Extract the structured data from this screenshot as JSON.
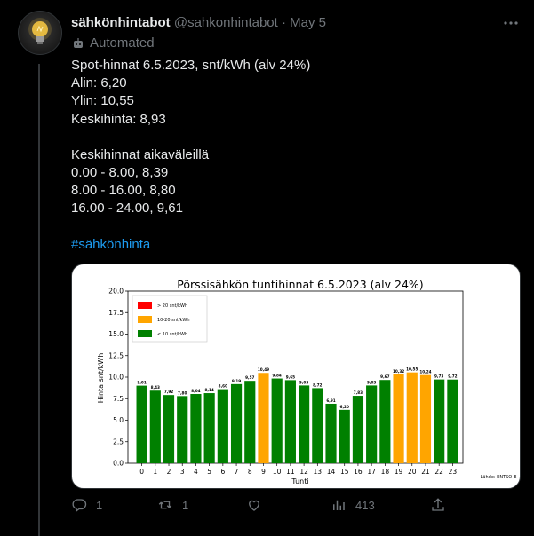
{
  "tweet": {
    "display_name": "sähkönhintabot",
    "handle": "@sahkonhintabot",
    "separator": "·",
    "date": "May 5",
    "automated_label": "Automated",
    "lines": [
      "Spot-hinnat 6.5.2023, snt/kWh (alv 24%)",
      "Alin: 6,20",
      "Ylin: 10,55",
      "Keskihinta: 8,93",
      "",
      "Keskihinnat aikaväleillä",
      "0.00 - 8.00, 8,39",
      "8.00 - 16.00, 8,80",
      "16.00 - 24.00, 9,61",
      ""
    ],
    "hashtag": "#sähkönhinta"
  },
  "actions": {
    "replies": "1",
    "retweets": "1",
    "likes": "",
    "views": "413"
  },
  "icons": {
    "more": "more-icon",
    "automated": "bot-icon",
    "reply": "reply-icon",
    "retweet": "retweet-icon",
    "like": "heart-icon",
    "views": "views-icon",
    "share": "share-icon"
  },
  "colors": {
    "green": "#008000",
    "orange": "#ffa500",
    "red": "#ff0000"
  },
  "chart_data": {
    "type": "bar",
    "title": "Pörssisähkön tuntihinnat 6.5.2023 (alv 24%)",
    "xlabel": "Tunti",
    "ylabel": "Hinta snt/kWh",
    "ylim": [
      0,
      20
    ],
    "yticks": [
      "0.0",
      "2.5",
      "5.0",
      "7.5",
      "10.0",
      "12.5",
      "15.0",
      "17.5",
      "20.0"
    ],
    "categories": [
      "0",
      "1",
      "2",
      "3",
      "4",
      "5",
      "6",
      "7",
      "8",
      "9",
      "10",
      "11",
      "12",
      "13",
      "14",
      "15",
      "16",
      "17",
      "18",
      "19",
      "20",
      "21",
      "22",
      "23"
    ],
    "values": [
      9.01,
      8.43,
      7.92,
      7.8,
      8.04,
      8.14,
      8.6,
      9.19,
      9.57,
      10.49,
      9.84,
      9.65,
      9.03,
      8.72,
      6.91,
      6.2,
      7.83,
      9.03,
      9.67,
      10.32,
      10.55,
      10.24,
      9.73,
      9.72
    ],
    "value_labels": [
      "9,01",
      "8,43",
      "7,92",
      "7,80",
      "8,04",
      "8,14",
      "8,60",
      "9,19",
      "9,57",
      "10,49",
      "9,84",
      "9,65",
      "9,03",
      "8,72",
      "6,91",
      "6,20",
      "7,83",
      "9,03",
      "9,67",
      "10,32",
      "10,55",
      "10,24",
      "9,73",
      "9,72"
    ],
    "legend": {
      "placement": "top-left",
      "entries": [
        {
          "label": "> 20 snt/kWh",
          "color": "#ff0000"
        },
        {
          "label": "10-20 snt/kWh",
          "color": "#ffa500"
        },
        {
          "label": "< 10 snt/kWh",
          "color": "#008000"
        }
      ]
    },
    "source_note": "Lähde: ENTSO-E",
    "grid": false
  }
}
